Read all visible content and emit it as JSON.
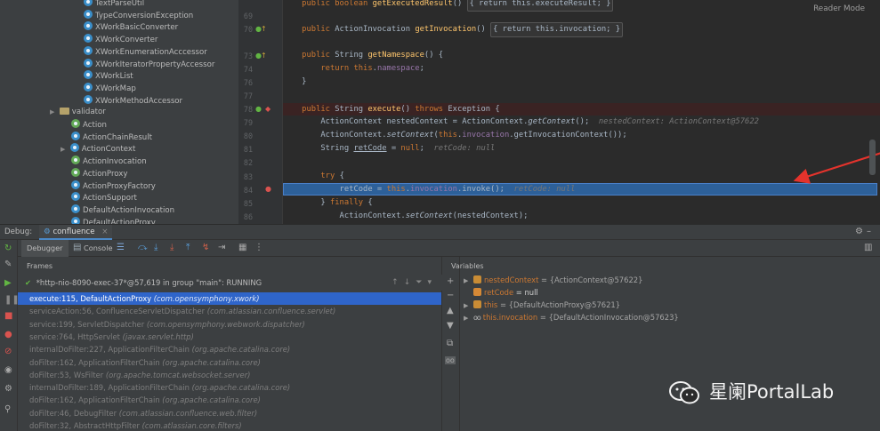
{
  "tree": {
    "items": [
      {
        "label": "TextParseUtil",
        "icon": "class-icon",
        "indent": 94,
        "color": "blue"
      },
      {
        "label": "TypeConversionException",
        "icon": "class-icon",
        "indent": 94,
        "color": "blue"
      },
      {
        "label": "XWorkBasicConverter",
        "icon": "class-icon",
        "indent": 94,
        "color": "blue"
      },
      {
        "label": "XWorkConverter",
        "icon": "class-icon",
        "indent": 94,
        "color": "blue"
      },
      {
        "label": "XWorkEnumerationAcccessor",
        "icon": "class-icon",
        "indent": 94,
        "color": "blue"
      },
      {
        "label": "XWorkIteratorPropertyAccessor",
        "icon": "class-icon",
        "indent": 94,
        "color": "blue"
      },
      {
        "label": "XWorkList",
        "icon": "class-icon",
        "indent": 94,
        "color": "blue"
      },
      {
        "label": "XWorkMap",
        "icon": "class-icon",
        "indent": 94,
        "color": "blue"
      },
      {
        "label": "XWorkMethodAccessor",
        "icon": "class-icon",
        "indent": 94,
        "color": "blue"
      },
      {
        "label": "validator",
        "icon": "package-icon",
        "indent": 68,
        "expandable": true
      },
      {
        "label": "Action",
        "icon": "interface-icon",
        "indent": 80,
        "color": "green"
      },
      {
        "label": "ActionChainResult",
        "icon": "class-icon",
        "indent": 80,
        "color": "blue"
      },
      {
        "label": "ActionContext",
        "icon": "class-icon",
        "indent": 80,
        "color": "blue",
        "expandable": true
      },
      {
        "label": "ActionInvocation",
        "icon": "interface-icon",
        "indent": 80,
        "color": "green"
      },
      {
        "label": "ActionProxy",
        "icon": "interface-icon",
        "indent": 80,
        "color": "green"
      },
      {
        "label": "ActionProxyFactory",
        "icon": "class-icon",
        "indent": 80,
        "color": "blue"
      },
      {
        "label": "ActionSupport",
        "icon": "class-icon",
        "indent": 80,
        "color": "blue"
      },
      {
        "label": "DefaultActionInvocation",
        "icon": "class-icon",
        "indent": 80,
        "color": "blue"
      },
      {
        "label": "DefaultActionProxy",
        "icon": "class-icon",
        "indent": 80,
        "color": "blue"
      }
    ]
  },
  "editor": {
    "reader_mode": "Reader Mode",
    "line_numbers": [
      "69",
      "70",
      "73",
      "74",
      "76",
      "77",
      "78",
      "79",
      "80",
      "81",
      "82",
      "83",
      "84",
      "85",
      "86"
    ],
    "lines": {
      "l68": [
        [
          "kw",
          "    public boolean "
        ],
        [
          "fn",
          "getExecutedResult"
        ],
        [
          "plain",
          "() "
        ],
        [
          "fold",
          "{ return this.executeResult; }"
        ]
      ],
      "l70": [
        [
          "kw",
          "    public "
        ],
        [
          "plain",
          "ActionInvocation "
        ],
        [
          "fn",
          "getInvocation"
        ],
        [
          "plain",
          "() "
        ],
        [
          "fold",
          "{ return this.invocation; }"
        ]
      ],
      "l74": [
        [
          "kw",
          "    public "
        ],
        [
          "plain",
          "String "
        ],
        [
          "fn",
          "getNamespace"
        ],
        [
          "plain",
          "() {"
        ]
      ],
      "l75": [
        [
          "kw",
          "        return this"
        ],
        [
          "plain",
          "."
        ],
        [
          "fld",
          "namespace"
        ],
        [
          "plain",
          ";"
        ]
      ],
      "l76": [
        [
          "plain",
          "    }"
        ]
      ],
      "l78": [
        [
          "kw",
          "    public "
        ],
        [
          "plain",
          "String "
        ],
        [
          "fn",
          "execute"
        ],
        [
          "plain",
          "() "
        ],
        [
          "kw",
          "throws "
        ],
        [
          "plain",
          "Exception {"
        ]
      ],
      "l79": [
        [
          "plain",
          "        ActionContext nestedContext = ActionContext."
        ],
        [
          "it",
          "getContext"
        ],
        [
          "plain",
          "();  "
        ],
        [
          "hint",
          "nestedContext: ActionContext@57622"
        ]
      ],
      "l80": [
        [
          "plain",
          "        ActionContext."
        ],
        [
          "it",
          "setContext"
        ],
        [
          "plain",
          "("
        ],
        [
          "kw",
          "this"
        ],
        [
          "plain",
          "."
        ],
        [
          "fld",
          "invocation"
        ],
        [
          "plain",
          ".getInvocationContext());"
        ]
      ],
      "l81": [
        [
          "plain",
          "        String "
        ],
        [
          "ul",
          "retCode"
        ],
        [
          "plain",
          " = "
        ],
        [
          "kw",
          "null"
        ],
        [
          "plain",
          ";  "
        ],
        [
          "hint",
          "retCode: null"
        ]
      ],
      "l83": [
        [
          "kw",
          "        try "
        ],
        [
          "plain",
          "{"
        ]
      ],
      "l84": [
        [
          "plain",
          "            retCode = "
        ],
        [
          "kw",
          "this"
        ],
        [
          "plain",
          "."
        ],
        [
          "fld",
          "invocation"
        ],
        [
          "plain",
          ".invoke();  "
        ],
        [
          "hint",
          "retCode: null"
        ]
      ],
      "l85": [
        [
          "plain",
          "        } "
        ],
        [
          "kw",
          "finally "
        ],
        [
          "plain",
          "{"
        ]
      ],
      "l86": [
        [
          "plain",
          "            ActionContext."
        ],
        [
          "it",
          "setContext"
        ],
        [
          "plain",
          "(nestedContext);"
        ]
      ]
    }
  },
  "debug": {
    "label": "Debug:",
    "session_tab": "confluence",
    "subtabs": {
      "debugger": "Debugger",
      "console": "Console"
    },
    "frames_title": "Frames",
    "thread": "*http-nio-8090-exec-37*@57,619 in group \"main\": RUNNING",
    "frames": [
      {
        "method": "execute:115, DefaultActionProxy",
        "pkg": "(com.opensymphony.xwork)"
      },
      {
        "method": "serviceAction:56, ConfluenceServletDispatcher",
        "pkg": "(com.atlassian.confluence.servlet)"
      },
      {
        "method": "service:199, ServletDispatcher",
        "pkg": "(com.opensymphony.webwork.dispatcher)"
      },
      {
        "method": "service:764, HttpServlet",
        "pkg": "(javax.servlet.http)"
      },
      {
        "method": "internalDoFilter:227, ApplicationFilterChain",
        "pkg": "(org.apache.catalina.core)"
      },
      {
        "method": "doFilter:162, ApplicationFilterChain",
        "pkg": "(org.apache.catalina.core)"
      },
      {
        "method": "doFilter:53, WsFilter",
        "pkg": "(org.apache.tomcat.websocket.server)"
      },
      {
        "method": "internalDoFilter:189, ApplicationFilterChain",
        "pkg": "(org.apache.catalina.core)"
      },
      {
        "method": "doFilter:162, ApplicationFilterChain",
        "pkg": "(org.apache.catalina.core)"
      },
      {
        "method": "doFilter:46, DebugFilter",
        "pkg": "(com.atlassian.confluence.web.filter)"
      },
      {
        "method": "doFilter:32, AbstractHttpFilter",
        "pkg": "(com.atlassian.core.filters)"
      }
    ],
    "variables_title": "Variables",
    "variables": [
      {
        "name": "nestedContext",
        "value": " = {ActionContext@57622}",
        "expandable": true,
        "icon": "field-icon"
      },
      {
        "name": "retCode",
        "value": " = null",
        "expandable": false,
        "icon": "field-icon"
      },
      {
        "name": "this",
        "value": " = {DefaultActionProxy@57621}",
        "expandable": true,
        "icon": "field-icon"
      },
      {
        "name": "this.invocation",
        "value": " = {DefaultActionInvocation@57623}",
        "expandable": true,
        "icon": "watch-icon"
      }
    ]
  },
  "watermark": {
    "text": "星阑PortalLab"
  },
  "colors": {
    "accent": "#2f65ca",
    "exec_line": "#2d6099",
    "keyword": "#cc7832",
    "method": "#ffc66d",
    "field": "#9876aa"
  }
}
